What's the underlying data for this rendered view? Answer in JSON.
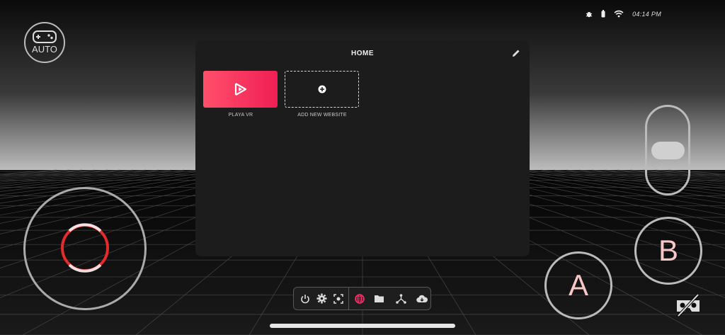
{
  "status_bar": {
    "time": "04:14 PM",
    "icons": [
      "bug-icon",
      "battery-icon",
      "wifi-icon"
    ]
  },
  "controller_mode": {
    "label": "AUTO",
    "icon": "gamepad-icon"
  },
  "panel": {
    "title": "HOME",
    "edit_icon": "pencil-icon",
    "tiles": [
      {
        "label": "PLAYA VR",
        "icon": "play-logo-icon",
        "color": "#f53b5e"
      },
      {
        "label": "ADD NEW WEBSITE",
        "icon": "plus-circle-icon"
      }
    ]
  },
  "gamepad": {
    "button_a": "A",
    "button_b": "B",
    "joystick_ring_color": "#e52b2b",
    "button_label_color": "#f6c7c7"
  },
  "toolbar": {
    "items": [
      {
        "name": "power",
        "icon": "power-icon",
        "active": false
      },
      {
        "name": "settings",
        "icon": "gear-icon",
        "active": false
      },
      {
        "name": "recenter",
        "icon": "recenter-icon",
        "active": false
      },
      {
        "name": "web",
        "icon": "globe-icon",
        "active": true
      },
      {
        "name": "files",
        "icon": "folder-icon",
        "active": false
      },
      {
        "name": "network",
        "icon": "network-icon",
        "active": false
      },
      {
        "name": "download",
        "icon": "cloud-download-icon",
        "active": false
      }
    ],
    "active_color": "#ff2d6a"
  },
  "colors": {
    "background": "#0b0b0b",
    "panel": "#1c1c1c",
    "accent": "#ff2d6a"
  }
}
